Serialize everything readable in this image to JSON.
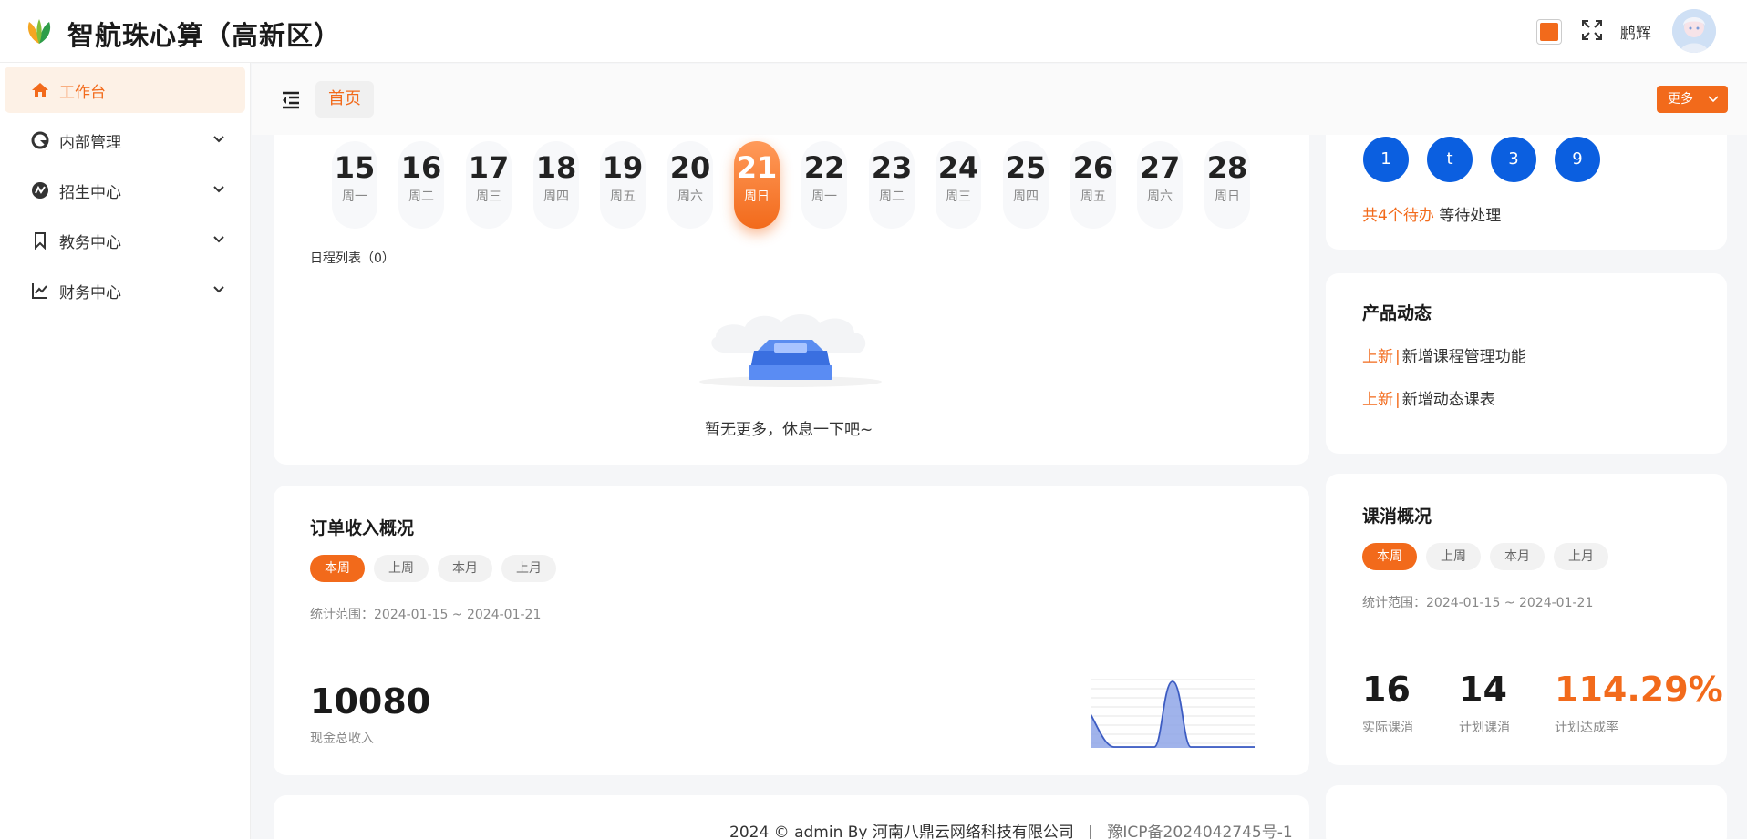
{
  "app": {
    "title": "智航珠心算（高新区）"
  },
  "header": {
    "theme_color": "#f26a1b",
    "user_name": "鹏辉"
  },
  "sidebar": {
    "items": [
      {
        "label": "工作台",
        "icon": "home-icon",
        "active": true
      },
      {
        "label": "内部管理",
        "icon": "internal-icon",
        "active": false
      },
      {
        "label": "招生中心",
        "icon": "enroll-icon",
        "active": false
      },
      {
        "label": "教务中心",
        "icon": "bookmark-icon",
        "active": false
      },
      {
        "label": "财务中心",
        "icon": "chart-line-icon",
        "active": false
      }
    ]
  },
  "tabs": {
    "home": "首页",
    "more": "更多"
  },
  "calendar": {
    "days": [
      {
        "num": "15",
        "weekday": "周一"
      },
      {
        "num": "16",
        "weekday": "周二"
      },
      {
        "num": "17",
        "weekday": "周三"
      },
      {
        "num": "18",
        "weekday": "周四"
      },
      {
        "num": "19",
        "weekday": "周五"
      },
      {
        "num": "20",
        "weekday": "周六"
      },
      {
        "num": "21",
        "weekday": "周日",
        "today": true
      },
      {
        "num": "22",
        "weekday": "周一"
      },
      {
        "num": "23",
        "weekday": "周二"
      },
      {
        "num": "24",
        "weekday": "周三"
      },
      {
        "num": "25",
        "weekday": "周四"
      },
      {
        "num": "26",
        "weekday": "周五"
      },
      {
        "num": "27",
        "weekday": "周六"
      },
      {
        "num": "28",
        "weekday": "周日"
      }
    ],
    "schedule_title": "日程列表（0）",
    "empty_text": "暂无更多，休息一下吧~"
  },
  "todo": {
    "items": [
      "1",
      "t",
      "3",
      "9"
    ],
    "summary_highlight": "共4个待办",
    "summary_rest": " 等待处理"
  },
  "product_news": {
    "title": "产品动态",
    "items": [
      {
        "tag": "上新",
        "sep": "|",
        "text": "新增课程管理功能"
      },
      {
        "tag": "上新",
        "sep": "|",
        "text": "新增动态课表"
      }
    ]
  },
  "order_income": {
    "title": "订单收入概况",
    "filters": [
      "本周",
      "上周",
      "本月",
      "上月"
    ],
    "range": "统计范围：2024-01-15 ~ 2024-01-21",
    "total": "10080",
    "total_label": "现金总收入"
  },
  "class_consumption": {
    "title": "课消概况",
    "filters": [
      "本周",
      "上周",
      "本月",
      "上月"
    ],
    "range": "统计范围：2024-01-15 ~ 2024-01-21",
    "stats": [
      {
        "value": "16",
        "label": "实际课消"
      },
      {
        "value": "14",
        "label": "计划课消"
      },
      {
        "value": "114.29%",
        "label": "计划达成率"
      }
    ]
  },
  "footer": {
    "copyright": "2024 © admin By 河南八鼎云网络科技有限公司",
    "divider": "|",
    "icp": "豫ICP备2024042745号-1"
  }
}
